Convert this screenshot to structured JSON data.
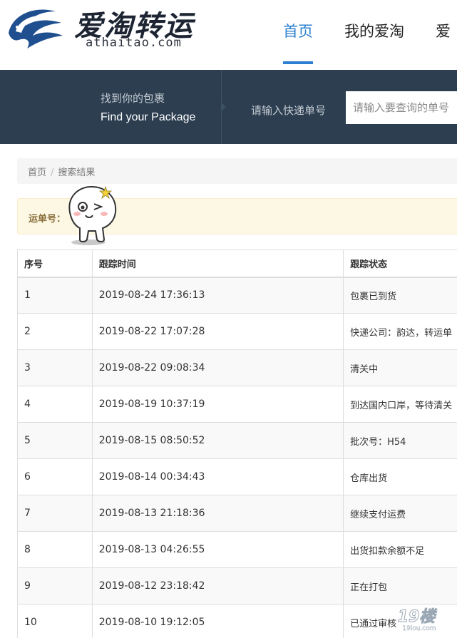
{
  "header": {
    "logo_cn": "爱淘转运",
    "logo_en": "athaitao.com",
    "nav": [
      {
        "label": "首页",
        "active": true
      },
      {
        "label": "我的爱淘",
        "active": false
      },
      {
        "label": "爱",
        "active": false
      }
    ]
  },
  "search_band": {
    "title_cn": "找到你的包裹",
    "title_en": "Find your Package",
    "input_label": "请输入快递单号",
    "input_placeholder": "请输入要查询的单号"
  },
  "breadcrumb": {
    "home": "首页",
    "separator": "/",
    "current": "搜索结果"
  },
  "tracking": {
    "label": "运单号："
  },
  "table": {
    "headers": [
      "序号",
      "跟踪时间",
      "跟踪状态"
    ],
    "rows": [
      {
        "no": "1",
        "time": "2019-08-24 17:36:13",
        "status": "包裹已到货"
      },
      {
        "no": "2",
        "time": "2019-08-22 17:07:28",
        "status": "快递公司：韵达，转运单"
      },
      {
        "no": "3",
        "time": "2019-08-22 09:08:34",
        "status": "清关中"
      },
      {
        "no": "4",
        "time": "2019-08-19 10:37:19",
        "status": "到达国内口岸，等待清关"
      },
      {
        "no": "5",
        "time": "2019-08-15 08:50:52",
        "status": "批次号：H54"
      },
      {
        "no": "6",
        "time": "2019-08-14 00:34:43",
        "status": "仓库出货"
      },
      {
        "no": "7",
        "time": "2019-08-13 21:18:36",
        "status": "继续支付运费"
      },
      {
        "no": "8",
        "time": "2019-08-13 04:26:55",
        "status": "出货扣款余额不足"
      },
      {
        "no": "9",
        "time": "2019-08-12 23:18:42",
        "status": "正在打包"
      },
      {
        "no": "10",
        "time": "2019-08-10 19:12:05",
        "status": "已通过审核"
      }
    ]
  },
  "watermark": {
    "text": "19楼",
    "subtext": "19lou.com"
  },
  "colors": {
    "accent": "#2b7fd1",
    "band_bg": "#2c3e50",
    "alert_bg": "#fcf8e3",
    "alert_text": "#8a6d3b"
  }
}
